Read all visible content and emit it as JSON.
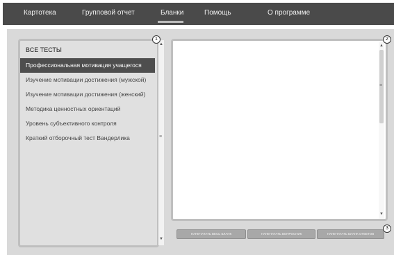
{
  "nav": {
    "items": [
      "Картотека",
      "Групповой отчет",
      "Бланки",
      "Помощь",
      "О программе"
    ]
  },
  "tests": {
    "header": "ВСЕ ТЕСТЫ",
    "items": [
      "Профессиональная мотивация учащегося",
      "Изучение мотивации достижения (мужской)",
      "Изучение мотивации достижения (женский)",
      "Методика ценностных ориентаций",
      "Уровень субъективного контроля",
      "Краткий отборочный тест Вандерлика"
    ],
    "selected_index": 0
  },
  "buttons": {
    "print_all": "НАПЕЧАТАТЬ ВЕСЬ БЛАНК",
    "print_questionnaire": "НАПЕЧАТАТЬ ВОПРОСНИК",
    "print_answers": "НАПЕЧАТАТЬ БЛАНК ОТВЕТОВ"
  },
  "callouts": [
    "1",
    "2",
    "3"
  ],
  "icons": {
    "scroll_up": "▲",
    "scroll_down": "▼",
    "grip": "≡"
  },
  "colors": {
    "nav_bg": "#4a4a4a",
    "content_bg": "#d9d9d9",
    "selected_bg": "#4e4e4e",
    "button_bg": "#a8a8a8"
  }
}
